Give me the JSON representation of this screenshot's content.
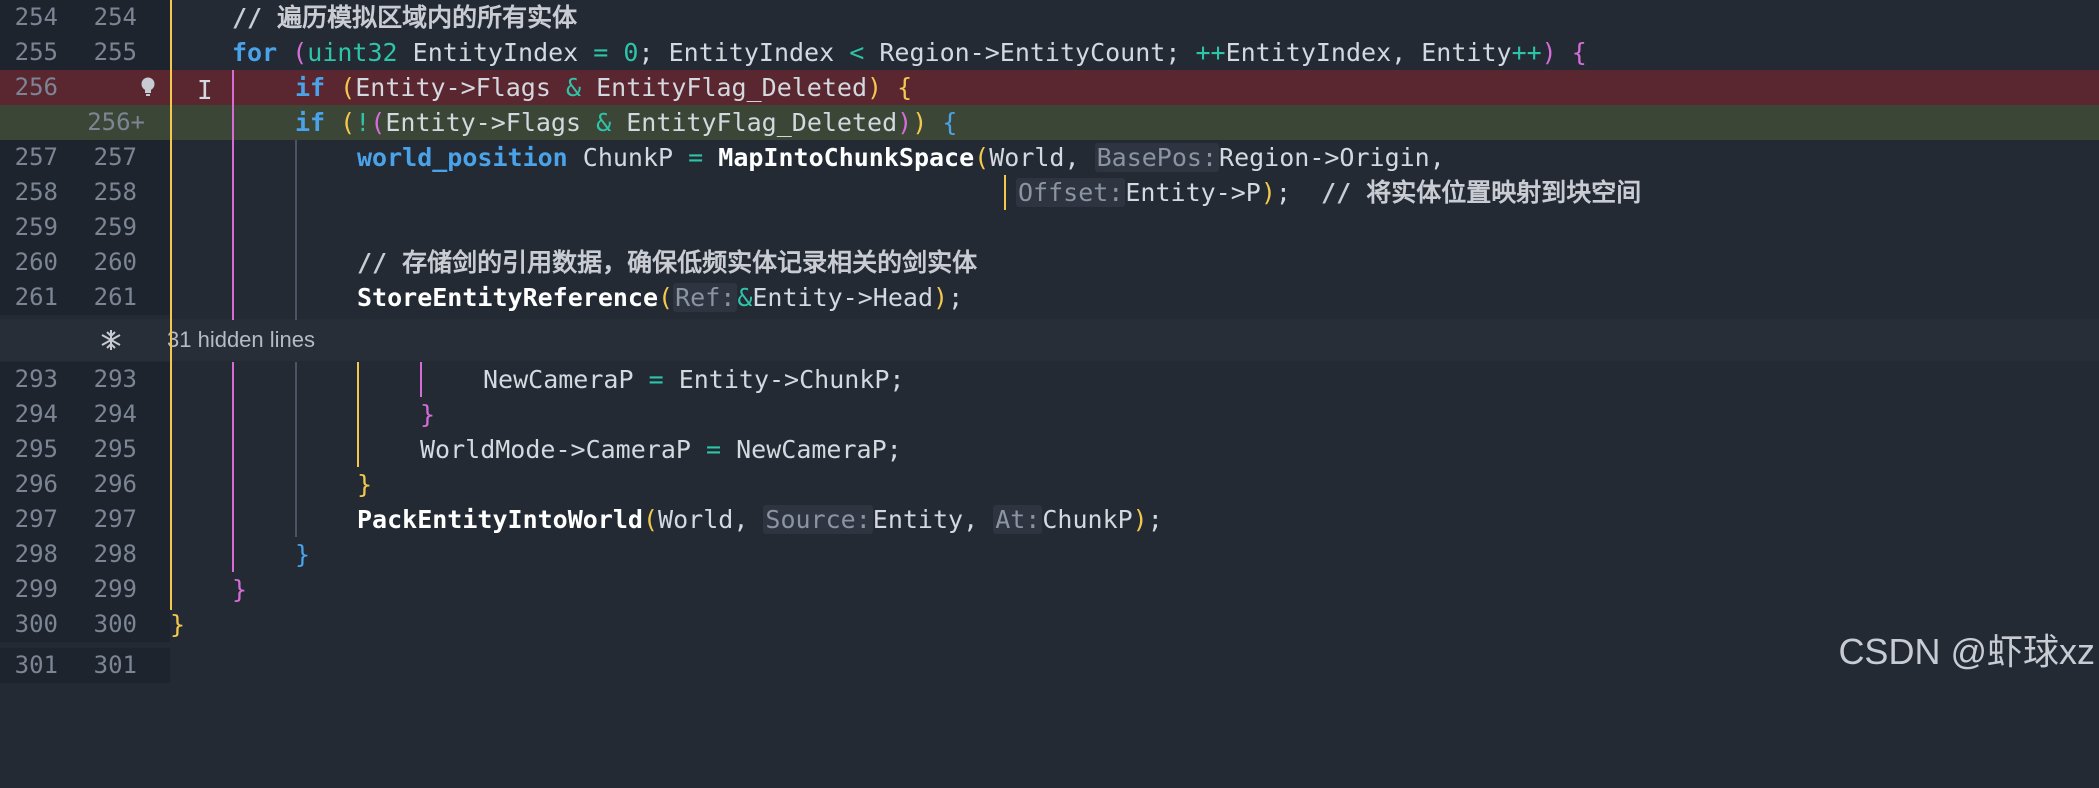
{
  "hidden_lines": {
    "label": "31 hidden lines",
    "icon": "unfold-icon"
  },
  "watermark": "CSDN @虾球xz",
  "lines": {
    "l254": {
      "old": "254",
      "new": "254",
      "comment": "// 遍历模拟区域内的所有实体"
    },
    "l255": {
      "old": "255",
      "new": "255"
    },
    "l256del": {
      "old": "256",
      "new": ""
    },
    "l256add": {
      "old": "",
      "new": "256+"
    },
    "l257": {
      "old": "257",
      "new": "257"
    },
    "l258": {
      "old": "258",
      "new": "258",
      "comment": "// 将实体位置映射到块空间"
    },
    "l259": {
      "old": "259",
      "new": "259"
    },
    "l260": {
      "old": "260",
      "new": "260",
      "comment": "// 存储剑的引用数据，确保低频实体记录相关的剑实体"
    },
    "l261": {
      "old": "261",
      "new": "261"
    },
    "l293": {
      "old": "293",
      "new": "293"
    },
    "l294": {
      "old": "294",
      "new": "294"
    },
    "l295": {
      "old": "295",
      "new": "295"
    },
    "l296": {
      "old": "296",
      "new": "296"
    },
    "l297": {
      "old": "297",
      "new": "297"
    },
    "l298": {
      "old": "298",
      "new": "298"
    },
    "l299": {
      "old": "299",
      "new": "299"
    },
    "l300": {
      "old": "300",
      "new": "300"
    },
    "l301": {
      "old": "301",
      "new": "301"
    }
  },
  "tokens": {
    "for": "for",
    "uint32": "uint32",
    "EntityIndex": "EntityIndex",
    "eq": "=",
    "zero": "0",
    "lt": "<",
    "RegionCount": "Region->EntityCount",
    "inc": "++",
    "Entity": "Entity",
    "if": "if",
    "EntityFlags": "Entity->Flags",
    "amp": "&",
    "FlagDeleted": "EntityFlag_Deleted",
    "bang": "!",
    "world_position": "world_position",
    "ChunkP": "ChunkP",
    "MapIntoChunkSpace": "MapIntoChunkSpace",
    "World": "World",
    "BasePos": "BasePos:",
    "RegionOrigin": "Region->Origin",
    "Offset": "Offset:",
    "EntityP": "Entity->P",
    "StoreEntityReference": "StoreEntityReference",
    "Ref": "Ref:",
    "EntityHead": "Entity->Head",
    "NewCameraP": "NewCameraP",
    "EntityChunkP": "Entity->ChunkP",
    "WorldModeCameraP": "WorldMode->CameraP",
    "PackEntityIntoWorld": "PackEntityIntoWorld",
    "Source": "Source:",
    "At": "At:"
  },
  "colors": {
    "background": "#232a34",
    "deleted_line": "#5a2630",
    "added_line": "#3c4636",
    "keyword": "#4aa3e8",
    "type": "#2ec4a9",
    "bracket_yellow": "#f2c94c",
    "bracket_magenta": "#d46ed6",
    "bracket_blue": "#4aa3e8"
  }
}
